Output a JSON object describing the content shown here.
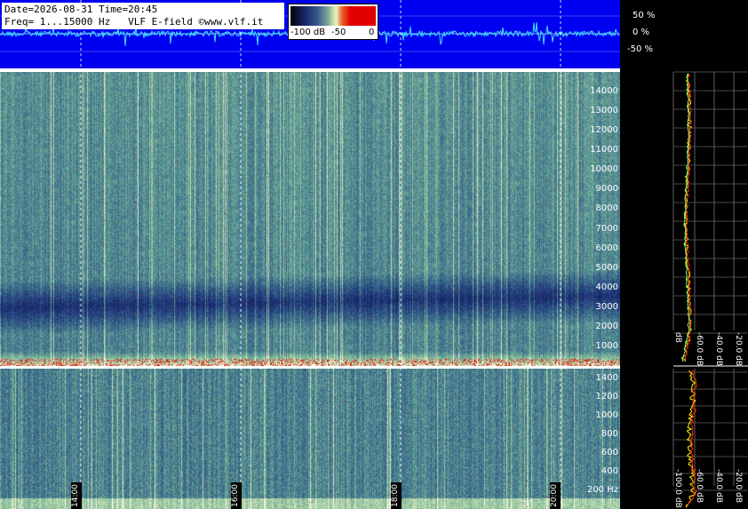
{
  "header": {
    "line1": "Date=2026-08-31 Time=20:45",
    "line2": "Freq= 1...15000 Hz   VLF E-field ©www.vlf.it"
  },
  "colorbar": {
    "labels": [
      "-100 dB",
      "-50",
      "0"
    ],
    "colors": [
      "#000010",
      "#1b2a6a",
      "#7fa6a0",
      "#c8e0a0",
      "#e00000"
    ]
  },
  "amplitude_scale": [
    "50 %",
    "0 %",
    "-50 %"
  ],
  "chart_data": [
    {
      "type": "heatmap",
      "title": "",
      "x_time_ticks": [
        "14:00",
        "16:00",
        "18:00",
        "20:00"
      ],
      "y_tick_labels": [
        "14000",
        "13000",
        "12000",
        "11000",
        "10000",
        "9000",
        "8000",
        "7000",
        "6000",
        "5000",
        "4000",
        "3000",
        "2000",
        "1000"
      ],
      "ylim": [
        0,
        15000
      ],
      "grid": true
    },
    {
      "type": "heatmap",
      "title": "",
      "x_time_ticks": [
        "14:00",
        "16:00",
        "18:00",
        "20:00"
      ],
      "y_tick_labels": [
        "1400",
        "1200",
        "1000",
        "800",
        "600",
        "400",
        "200 Hz"
      ],
      "ylim": [
        0,
        1500
      ],
      "grid": true
    },
    {
      "type": "line",
      "title": "",
      "x_tick_labels": [
        "dB",
        "-60.0 dB",
        "-40.0 dB",
        "-20.0 dB"
      ],
      "series_colors": [
        "#ffff00",
        "#ff2a00",
        "#80ff80"
      ]
    },
    {
      "type": "line",
      "title": "",
      "x_tick_labels": [
        "-100.0 dB",
        "-60.0 dB",
        "-40.0 dB",
        "-20.0 dB"
      ],
      "series_colors": [
        "#ffff00",
        "#ff2a00",
        "#80ff80"
      ]
    }
  ]
}
